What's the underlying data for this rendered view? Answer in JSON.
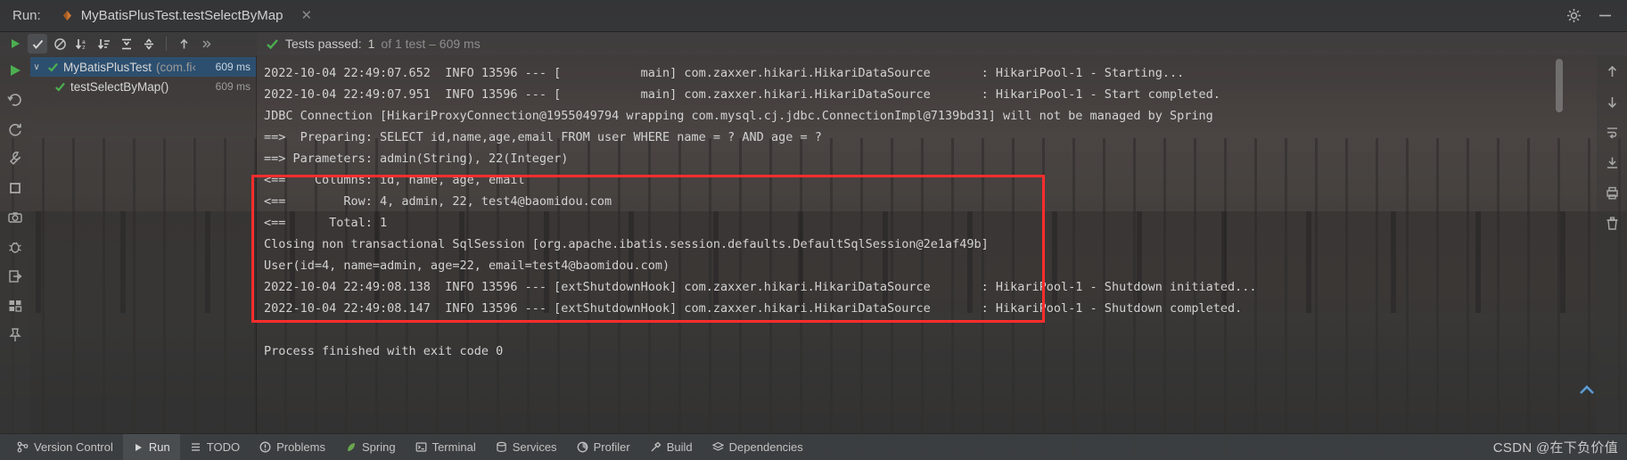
{
  "window": {
    "run_label": "Run:",
    "tab_title": "MyBatisPlusTest.testSelectByMap",
    "close_icon": "close-icon",
    "settings_icon": "gear-icon",
    "minimize_icon": "minimize-icon"
  },
  "toolbar": {
    "buttons": [
      {
        "name": "rerun-button",
        "icon": "play-icon",
        "active": false
      },
      {
        "name": "show-passed-toggle",
        "icon": "checkmark-icon",
        "active": true
      },
      {
        "name": "show-ignored-toggle",
        "icon": "no-entry-icon",
        "active": false
      },
      {
        "name": "sort-alphabetically-button",
        "icon": "sort-alpha-icon",
        "active": false
      },
      {
        "name": "sort-by-duration-button",
        "icon": "sort-duration-icon",
        "active": false
      },
      {
        "name": "expand-all-button",
        "icon": "expand-all-icon",
        "active": false
      },
      {
        "name": "collapse-all-button",
        "icon": "collapse-all-icon",
        "active": false
      },
      {
        "name": "previous-failed-button",
        "icon": "arrow-up-icon",
        "active": false
      },
      {
        "name": "more-options-button",
        "icon": "chevron-double-right-icon",
        "active": false
      }
    ],
    "status_icon": "green-check-icon",
    "status_main": "Tests passed:",
    "status_count": "1",
    "status_suffix": "of 1 test – 609 ms"
  },
  "left_rail": {
    "icons": [
      {
        "name": "run-icon",
        "glyph": "play"
      },
      {
        "name": "rerun-failed-icon",
        "glyph": "rerun"
      },
      {
        "name": "rerun-automatically-icon",
        "glyph": "refresh"
      },
      {
        "name": "settings-wrench-icon",
        "glyph": "wrench"
      },
      {
        "name": "stop-icon",
        "glyph": "square"
      },
      {
        "name": "screenshot-icon",
        "glyph": "camera"
      },
      {
        "name": "bug-icon",
        "glyph": "bug"
      },
      {
        "name": "export-icon",
        "glyph": "export"
      },
      {
        "name": "layout-icon",
        "glyph": "layout"
      },
      {
        "name": "pin-icon",
        "glyph": "pin"
      }
    ]
  },
  "right_rail": {
    "icons": [
      {
        "name": "scroll-up-icon",
        "glyph": "arrow-up"
      },
      {
        "name": "scroll-down-icon",
        "glyph": "arrow-down"
      },
      {
        "name": "soft-wrap-icon",
        "glyph": "wrap"
      },
      {
        "name": "scroll-to-end-icon",
        "glyph": "scroll-end"
      },
      {
        "name": "print-icon",
        "glyph": "print"
      },
      {
        "name": "clear-all-icon",
        "glyph": "trash"
      }
    ]
  },
  "test_tree": {
    "rows": [
      {
        "name": "tree-row-suite",
        "selected": true,
        "chevron": "∨",
        "status_icon": "green-check-icon",
        "label": "MyBatisPlusTest",
        "package": "(com.fi‹",
        "time": "609 ms",
        "indented": false
      },
      {
        "name": "tree-row-test",
        "selected": false,
        "chevron": "",
        "status_icon": "green-check-icon",
        "label": "testSelectByMap()",
        "package": "",
        "time": "609 ms",
        "indented": true
      }
    ]
  },
  "console": {
    "lines": [
      "2022-10-04 22:49:07.652  INFO 13596 --- [           main] com.zaxxer.hikari.HikariDataSource       : HikariPool-1 - Starting...",
      "2022-10-04 22:49:07.951  INFO 13596 --- [           main] com.zaxxer.hikari.HikariDataSource       : HikariPool-1 - Start completed.",
      "JDBC Connection [HikariProxyConnection@1955049794 wrapping com.mysql.cj.jdbc.ConnectionImpl@7139bd31] will not be managed by Spring",
      "==>  Preparing: SELECT id,name,age,email FROM user WHERE name = ? AND age = ?",
      "==> Parameters: admin(String), 22(Integer)",
      "<==    Columns: id, name, age, email",
      "<==        Row: 4, admin, 22, test4@baomidou.com",
      "<==      Total: 1",
      "Closing non transactional SqlSession [org.apache.ibatis.session.defaults.DefaultSqlSession@2e1af49b]",
      "User(id=4, name=admin, age=22, email=test4@baomidou.com)",
      "2022-10-04 22:49:08.138  INFO 13596 --- [extShutdownHook] com.zaxxer.hikari.HikariDataSource       : HikariPool-1 - Shutdown initiated...",
      "2022-10-04 22:49:08.147  INFO 13596 --- [extShutdownHook] com.zaxxer.hikari.HikariDataSource       : HikariPool-1 - Shutdown completed.",
      "",
      "Process finished with exit code 0"
    ],
    "annotation_color": "#ff2d2d"
  },
  "statusbar": {
    "items": [
      {
        "name": "statusbar-tab-version-control",
        "icon": "branch-icon",
        "label": "Version Control",
        "active": false
      },
      {
        "name": "statusbar-tab-run",
        "icon": "play-icon",
        "label": "Run",
        "active": true
      },
      {
        "name": "statusbar-tab-todo",
        "icon": "list-icon",
        "label": "TODO",
        "active": false
      },
      {
        "name": "statusbar-tab-problems",
        "icon": "warning-icon",
        "label": "Problems",
        "active": false
      },
      {
        "name": "statusbar-tab-spring",
        "icon": "leaf-icon",
        "label": "Spring",
        "active": false
      },
      {
        "name": "statusbar-tab-terminal",
        "icon": "terminal-icon",
        "label": "Terminal",
        "active": false
      },
      {
        "name": "statusbar-tab-services",
        "icon": "services-icon",
        "label": "Services",
        "active": false
      },
      {
        "name": "statusbar-tab-profiler",
        "icon": "profiler-icon",
        "label": "Profiler",
        "active": false
      },
      {
        "name": "statusbar-tab-build",
        "icon": "hammer-icon",
        "label": "Build",
        "active": false
      },
      {
        "name": "statusbar-tab-dependencies",
        "icon": "layers-icon",
        "label": "Dependencies",
        "active": false
      }
    ],
    "watermark": "CSDN @在下负价值"
  }
}
